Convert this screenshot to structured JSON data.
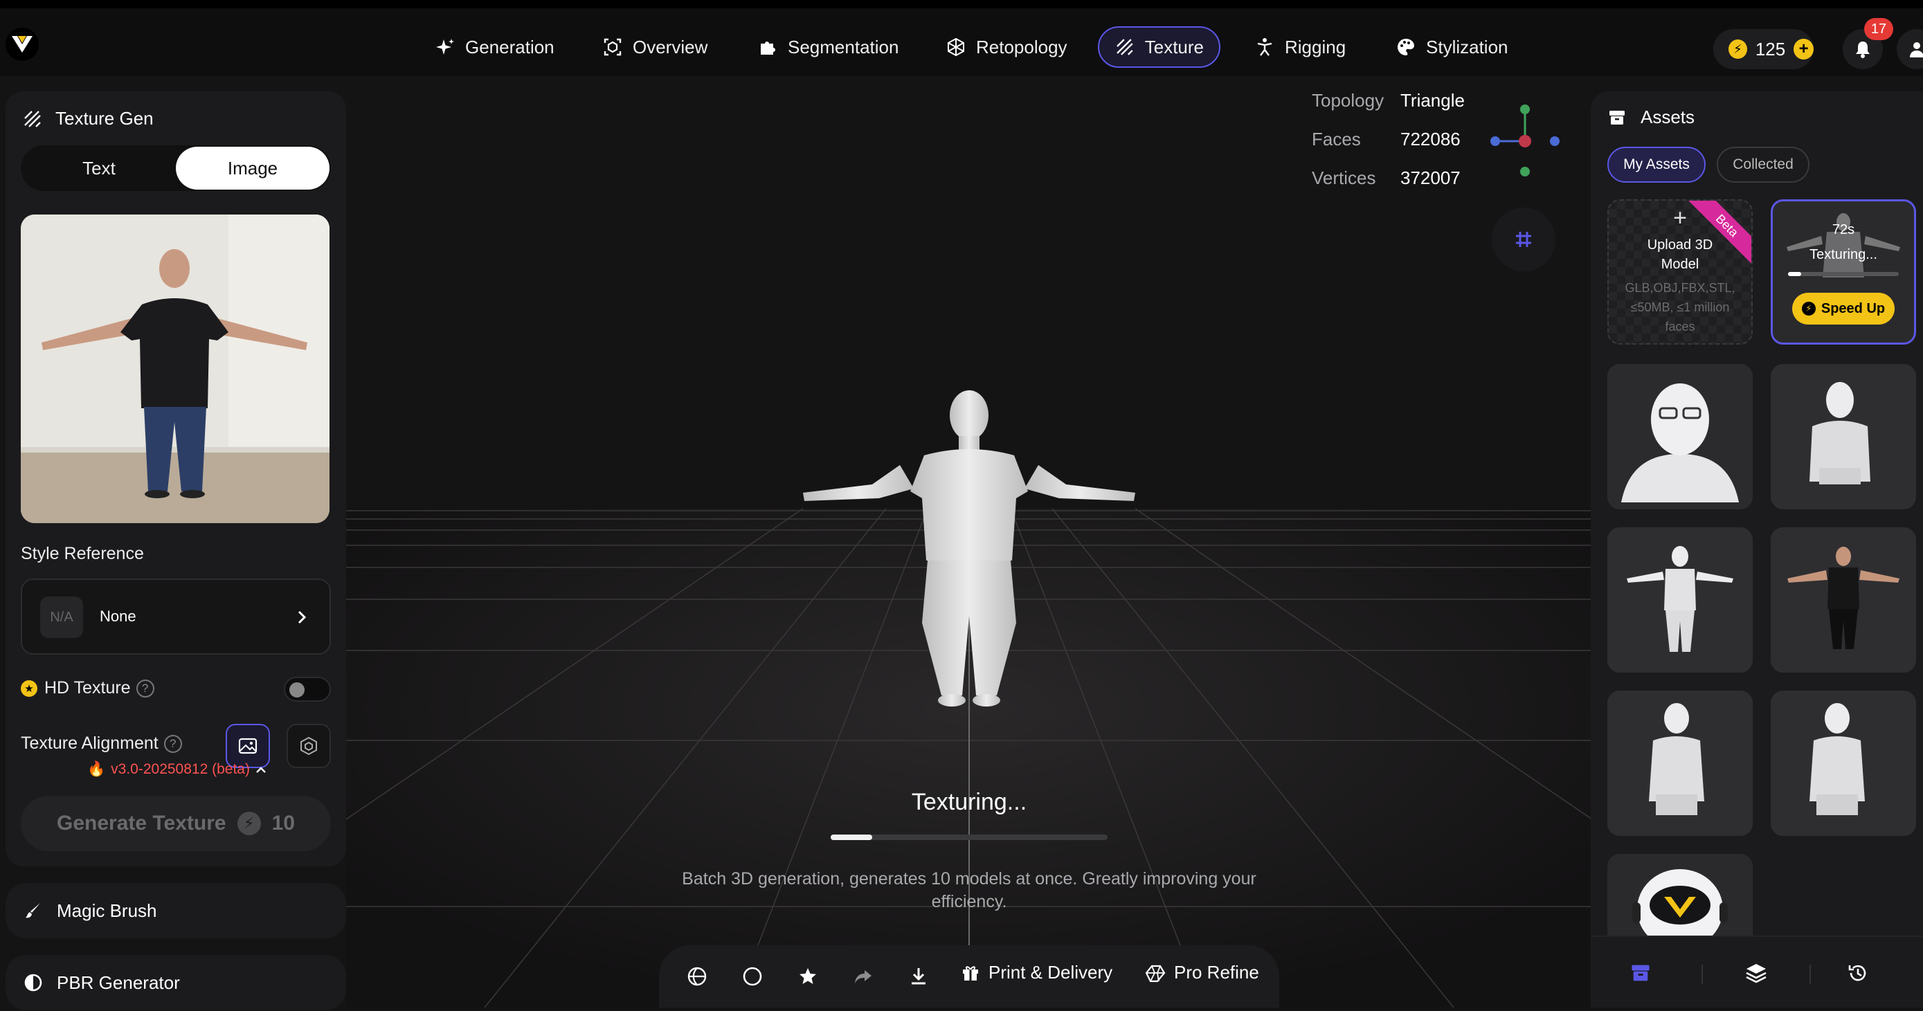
{
  "nav": {
    "items": [
      {
        "label": "Generation",
        "icon": "sparkle-icon"
      },
      {
        "label": "Overview",
        "icon": "overview-icon"
      },
      {
        "label": "Segmentation",
        "icon": "puzzle-icon"
      },
      {
        "label": "Retopology",
        "icon": "mesh-icon"
      },
      {
        "label": "Texture",
        "icon": "texture-icon",
        "active": true
      },
      {
        "label": "Rigging",
        "icon": "rigging-icon"
      },
      {
        "label": "Stylization",
        "icon": "palette-icon"
      }
    ],
    "credits": "125",
    "notification_count": "17"
  },
  "left_panel": {
    "title": "Texture Gen",
    "tabs": [
      "Text",
      "Image"
    ],
    "active_tab": "Image",
    "style_reference_label": "Style Reference",
    "style_reference_thumb": "N/A",
    "style_reference_value": "None",
    "hd_texture_label": "HD Texture",
    "hd_texture_on": false,
    "help_glyph": "?",
    "texture_alignment_label": "Texture Alignment",
    "version": "v3.0-20250812 (beta)",
    "generate_label": "Generate Texture",
    "generate_cost": "10",
    "magic_brush_label": "Magic Brush",
    "pbr_label": "PBR Generator"
  },
  "viewport": {
    "stats": [
      {
        "key": "Topology",
        "value": "Triangle"
      },
      {
        "key": "Faces",
        "value": "722086"
      },
      {
        "key": "Vertices",
        "value": "372007"
      }
    ],
    "status": "Texturing...",
    "progress": 0.15,
    "description": "Batch 3D generation, generates 10 models at once. Greatly improving your efficiency."
  },
  "bottom_bar": {
    "print_label": "Print & Delivery",
    "refine_label": "Pro Refine"
  },
  "assets": {
    "title": "Assets",
    "tabs": [
      "My Assets",
      "Collected"
    ],
    "upload_title": "Upload 3D Model",
    "upload_hint": "GLB,OBJ,FBX,STL, ≤50MB, ≤1 million faces",
    "beta": "Beta",
    "texturing_time": "72s",
    "texturing_label": "Texturing...",
    "texturing_progress": 0.12,
    "speed_up": "Speed Up"
  },
  "colors": {
    "accent": "#5b57e6",
    "gold": "#f3c316",
    "danger": "#ff5252",
    "beta": "#d6299b"
  }
}
